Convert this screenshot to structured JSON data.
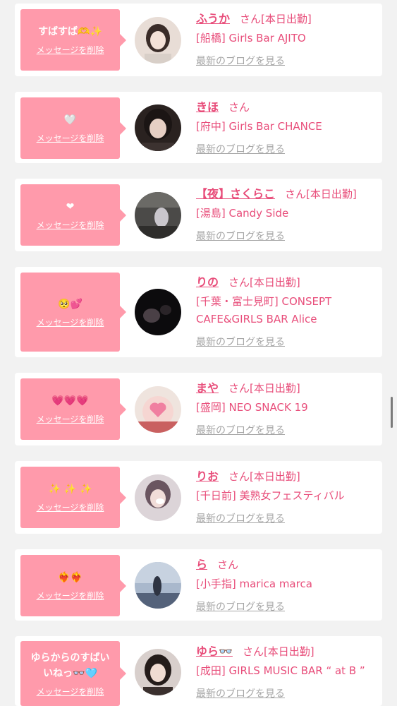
{
  "delete_label": "メッセージを削除",
  "blog_label": "最新のブログを見る",
  "san_label": "さん",
  "accent_color": "#e84d7a",
  "bubble_color": "#ff9aab",
  "cards": [
    {
      "message": "すばすば🫶✨",
      "name": "ふうか",
      "status": "[本日出勤]",
      "shop": "[船橋] Girls Bar AJITO"
    },
    {
      "message": "🤍",
      "name": "きほ",
      "status": "",
      "shop": "[府中] Girls Bar CHANCE"
    },
    {
      "message": "❤",
      "name": "【夜】さくらこ",
      "status": "[本日出勤]",
      "shop": "[湯島] Candy Side"
    },
    {
      "message": "🥺💕",
      "name": "りの",
      "status": "[本日出勤]",
      "shop": "[千葉・富士見町] CONSEPT CAFE&GIRLS BAR Alice"
    },
    {
      "message": "💗💗💗",
      "name": "まや",
      "status": "[本日出勤]",
      "shop": "[盛岡] NEO SNACK 19"
    },
    {
      "message": "✨ ✨ ✨",
      "name": "りお",
      "status": "[本日出勤]",
      "shop": "[千日前] 美熟女フェスティバル"
    },
    {
      "message": "❤️‍🔥❤️‍🔥",
      "name": "ら",
      "status": "",
      "shop": "[小手指] marica marca"
    },
    {
      "message": "ゆらからのすばい\nいねっ👓🩵",
      "name": "ゆら👓",
      "status": "[本日出勤]",
      "shop": "[成田] GIRLS MUSIC BAR “ at B ”"
    }
  ]
}
